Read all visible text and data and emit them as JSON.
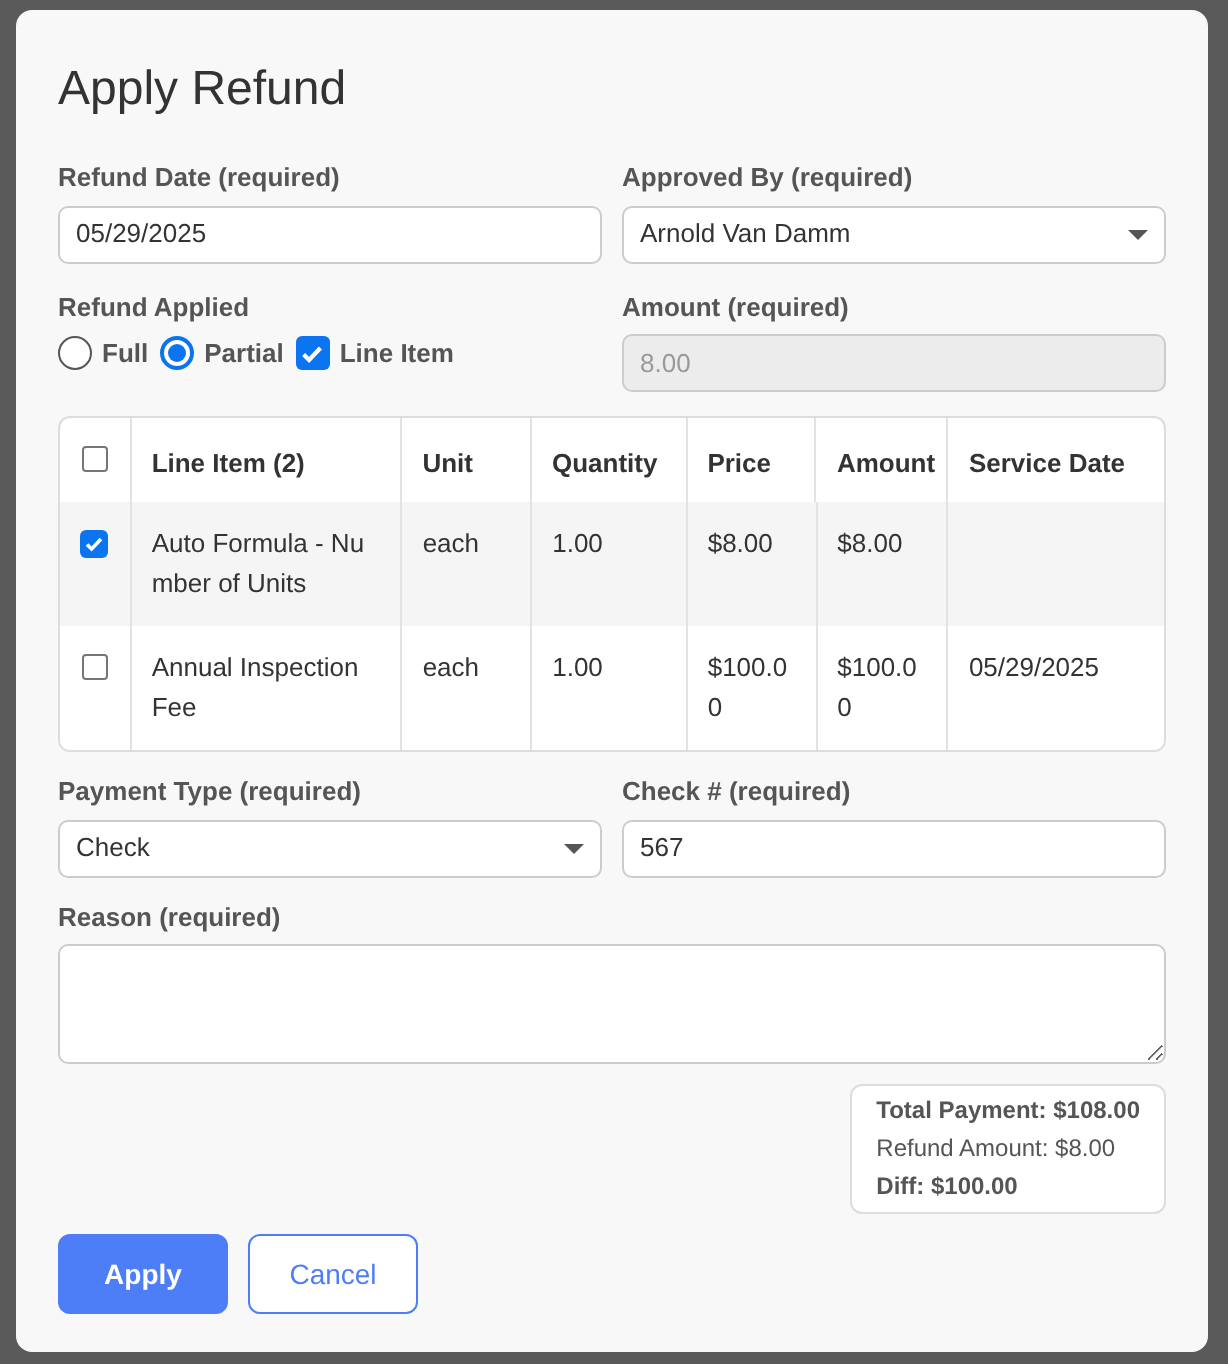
{
  "dialog": {
    "title": "Apply Refund"
  },
  "refund_date": {
    "label": "Refund Date  (required)",
    "value": "05/29/2025"
  },
  "approved_by": {
    "label": "Approved By (required)",
    "value": "Arnold Van Damm"
  },
  "refund_applied": {
    "label": "Refund Applied",
    "options": [
      {
        "kind": "radio",
        "label": "Full",
        "selected": false
      },
      {
        "kind": "radio",
        "label": "Partial",
        "selected": true
      },
      {
        "kind": "checkbox",
        "label": "Line Item",
        "checked": true
      }
    ]
  },
  "amount": {
    "label": "Amount  (required)",
    "value": "8.00",
    "disabled": true
  },
  "table": {
    "select_all_checked": false,
    "columns": [
      "Line Item (2)",
      "Unit",
      "Quantity",
      "Price",
      "Amount",
      "Service Date"
    ],
    "rows": [
      {
        "checked": true,
        "cells": [
          "Auto Formula - Number of Units",
          "each",
          "1.00",
          "$8.00",
          "$8.00",
          ""
        ]
      },
      {
        "checked": false,
        "cells": [
          "Annual Inspection Fee",
          "each",
          "1.00",
          "$100.00",
          "$100.00",
          "05/29/2025"
        ]
      }
    ]
  },
  "payment_type": {
    "label": "Payment Type (required)",
    "value": "Check"
  },
  "check_number": {
    "label": "Check #  (required)",
    "value": "567"
  },
  "reason": {
    "label": "Reason  (required)"
  },
  "summary": [
    {
      "kind": "bold",
      "text": "Total Payment: $108.00"
    },
    {
      "kind": "normal",
      "text": "Refund Amount: $8.00"
    },
    {
      "kind": "bold",
      "text": "Diff: $100.00"
    }
  ],
  "buttons": [
    {
      "kind": "primary",
      "label": "Apply"
    },
    {
      "kind": "secondary",
      "label": "Cancel"
    }
  ]
}
